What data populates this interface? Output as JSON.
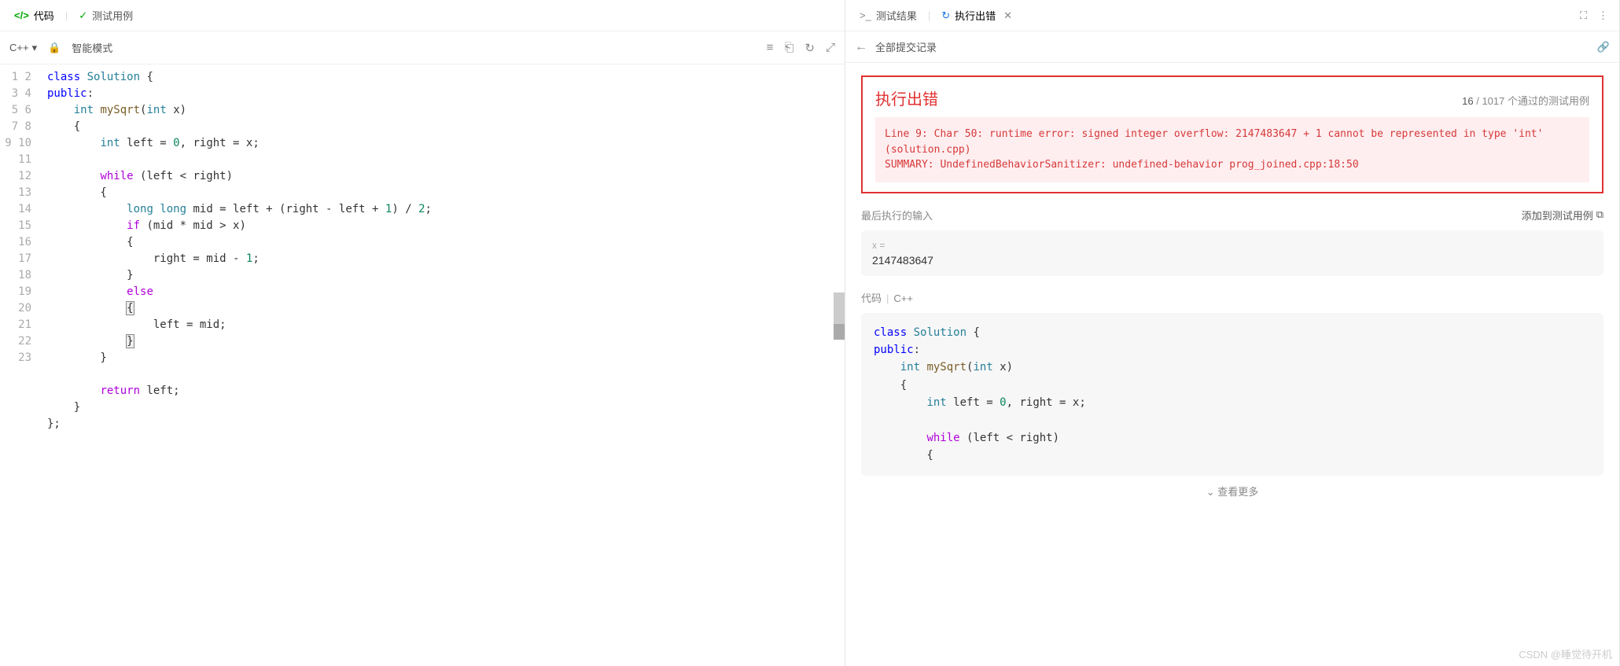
{
  "leftTabs": {
    "code": "代码",
    "tests": "测试用例"
  },
  "toolbar": {
    "language": "C++",
    "mode": "智能模式"
  },
  "code": {
    "lines": [
      "1",
      "2",
      "3",
      "4",
      "5",
      "6",
      "7",
      "8",
      "9",
      "10",
      "11",
      "12",
      "13",
      "14",
      "15",
      "16",
      "17",
      "18",
      "19",
      "20",
      "21",
      "22",
      "23"
    ]
  },
  "rightTabs": {
    "result": "测试结果",
    "error": "执行出错"
  },
  "nav": {
    "allSubmissions": "全部提交记录"
  },
  "error": {
    "title": "执行出错",
    "passed": "16",
    "total": "1017",
    "suffix": "个通过的测试用例",
    "message": "Line 9: Char 50: runtime error: signed integer overflow: 2147483647 + 1 cannot be represented in type 'int' (solution.cpp)\nSUMMARY: UndefinedBehaviorSanitizer: undefined-behavior prog_joined.cpp:18:50"
  },
  "lastInput": {
    "label": "最后执行的输入",
    "addLabel": "添加到测试用例",
    "varLabel": "x =",
    "value": "2147483647"
  },
  "codeSection": {
    "label": "代码",
    "lang": "C++"
  },
  "more": "查看更多",
  "watermark": "CSDN @睡觉待开机"
}
